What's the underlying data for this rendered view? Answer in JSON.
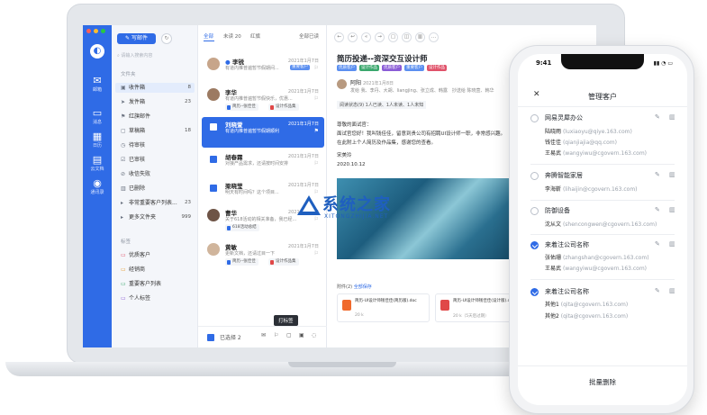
{
  "colors": {
    "accent": "#2f6be6",
    "rail": "#2f6be6",
    "selected_row": "#2f6be6"
  },
  "rail": {
    "items": [
      {
        "icon": "mail-icon",
        "label": "邮箱"
      },
      {
        "icon": "message-icon",
        "label": "消息"
      },
      {
        "icon": "calendar-icon",
        "label": "日历"
      },
      {
        "icon": "document-icon",
        "label": "云文档"
      },
      {
        "icon": "contacts-icon",
        "label": "通讯录"
      }
    ]
  },
  "folders": {
    "compose_label": "写邮件",
    "search_placeholder": "请输入搜索内容",
    "section_folders": "文件夹",
    "items": [
      {
        "icon": "inbox-icon",
        "label": "收件箱",
        "count": "8"
      },
      {
        "icon": "send-icon",
        "label": "发件箱",
        "count": "23"
      },
      {
        "icon": "flag-icon",
        "label": "红旗邮件",
        "count": ""
      },
      {
        "icon": "draft-icon",
        "label": "草稿箱",
        "count": "18"
      },
      {
        "icon": "pending-icon",
        "label": "待审核",
        "count": ""
      },
      {
        "icon": "approved-icon",
        "label": "已审核",
        "count": ""
      },
      {
        "icon": "failed-icon",
        "label": "收信失败",
        "count": ""
      },
      {
        "icon": "trash-icon",
        "label": "已删除",
        "count": ""
      },
      {
        "icon": "folder-icon",
        "label": "非常重要客户列表...",
        "count": "23"
      },
      {
        "icon": "folder-icon",
        "label": "更多文件夹",
        "count": "999"
      }
    ],
    "section_tags": "标签",
    "tags": [
      {
        "label": "优质客户",
        "color": "#e0526a"
      },
      {
        "label": "经销商",
        "color": "#e59b2b"
      },
      {
        "label": "重要客户列表",
        "color": "#3aa76d"
      },
      {
        "label": "个人标签",
        "color": "#8a5cd6"
      }
    ]
  },
  "list": {
    "tabs": [
      "全部",
      "未读 20",
      "红旗",
      "全部已读"
    ],
    "items": [
      {
        "sender": "李锐",
        "dot": "●",
        "preview": "有道内推普遍暂节假期间...",
        "time": "2021年1月7日",
        "tag": "重要客户",
        "attachments": []
      },
      {
        "sender": "李华",
        "dot": "",
        "preview": "有道内推普遍暂节假快乐，优惠...",
        "time": "2021年1月7日",
        "tag": "",
        "attachments": [
          {
            "name": "简历--张佳佳",
            "color": "#2f6be6"
          },
          {
            "name": "设计作品集",
            "color": "#e04848"
          }
        ]
      },
      {
        "sender": "刘晓萱",
        "dot": "",
        "preview": "有道内推普遍暂节假期顺利",
        "time": "2021年1月7日",
        "tag": "",
        "attachments": []
      },
      {
        "sender": "胡春霖",
        "dot": "",
        "preview": "对接产品需求，还请按时间安排",
        "time": "2021年1月7日",
        "tag": "",
        "attachments": []
      },
      {
        "sender": "梁晓莹",
        "dot": "",
        "preview": "明天有时间吗？这个项目...",
        "time": "2021年1月7日",
        "tag": "",
        "attachments": []
      },
      {
        "sender": "曹华",
        "dot": "",
        "preview": "关于618活动的相关准备，我已经...",
        "time": "2021年1月7日",
        "tag": "",
        "attachments": [
          {
            "name": "618活动总结",
            "color": "#2f6be6"
          }
        ]
      },
      {
        "sender": "黄敏",
        "dot": "",
        "preview": "更新文档，还请过目一下",
        "time": "2021年1月7日",
        "tag": "",
        "attachments": [
          {
            "name": "简历--张佳佳",
            "color": "#2f6be6"
          },
          {
            "name": "设计作品集",
            "color": "#e04848"
          }
        ]
      }
    ],
    "footer_selected": "已选择 2",
    "tooltip": "打标签"
  },
  "reader": {
    "title": "简历投递--资深交互设计师",
    "labels": [
      {
        "text": "优质客户",
        "color": "#5b8ff0"
      },
      {
        "text": "设计作品",
        "color": "#3aa76d"
      },
      {
        "text": "优质客户",
        "color": "#8a5cd6"
      },
      {
        "text": "重要客户",
        "color": "#5b8ff0"
      },
      {
        "text": "设计作品",
        "color": "#e0526a"
      }
    ],
    "sender": "阿阳",
    "sent_time": "2021年1月8日",
    "recipients": "发给 我、李丹、大胡、liangjing、张立成、韩露",
    "cc": "抄送给 陈晓萱、韩华",
    "read_status": "阅读状态(9)  1人已读、1人未读、1人未知",
    "greeting": "尊敬的面试官：",
    "body": "面试官您好！我叫钱佳佳，留意到贵公司有招聘UI设计师一职，非常感兴趣。在此附上个人简历及作品集，感谢您的查看。",
    "signature": "宋美玲",
    "date": "2020.10.12",
    "attach_note": "附件(2)",
    "attach_all": "全部保存",
    "attachments": [
      {
        "name": "简历-UI设计师钱佳佳(简历版).doc",
        "size": "20 k",
        "icon": "word-icon",
        "color": "#f06a2c"
      },
      {
        "name": "简历-UI设计师钱佳佳(设计版).doc",
        "size": "20 k（5天后过期）",
        "icon": "pdf-icon",
        "color": "#e04848"
      }
    ]
  },
  "phone": {
    "time": "9:41",
    "title": "管理客户",
    "groups": [
      {
        "name": "网易灵犀办公",
        "checked": false,
        "members": [
          {
            "name": "陆晓雨",
            "email": "luxiaoyu@qiye.163.com"
          },
          {
            "name": "钱佳佳",
            "email": "qianjiajia@qq.com"
          },
          {
            "name": "王易武",
            "email": "wangyiwu@cgovern.163.com"
          }
        ]
      },
      {
        "name": "奔腾智能家居",
        "checked": false,
        "members": [
          {
            "name": "李海靳",
            "email": "lihaijin@cgovern.163.com"
          }
        ]
      },
      {
        "name": "防御设备",
        "checked": false,
        "members": [
          {
            "name": "沈从文",
            "email": "shencongwen@cgovern.163.com"
          }
        ]
      },
      {
        "name": "来着注公司名称",
        "checked": true,
        "members": [
          {
            "name": "张佑珊",
            "email": "zhangshan@cgovern.163.com"
          },
          {
            "name": "王易武",
            "email": "wangyiwu@cgovern.163.com"
          }
        ]
      },
      {
        "name": "来着注公司名称",
        "checked": true,
        "members": [
          {
            "name": "其他1",
            "email": "qita@cgovern.163.com"
          },
          {
            "name": "其他2",
            "email": "qita@cgovern.163.com"
          }
        ]
      }
    ],
    "bulk_delete": "批量删除"
  },
  "watermark": {
    "text": "系统之家",
    "sub": "XITONGZHIJIA.NET"
  }
}
